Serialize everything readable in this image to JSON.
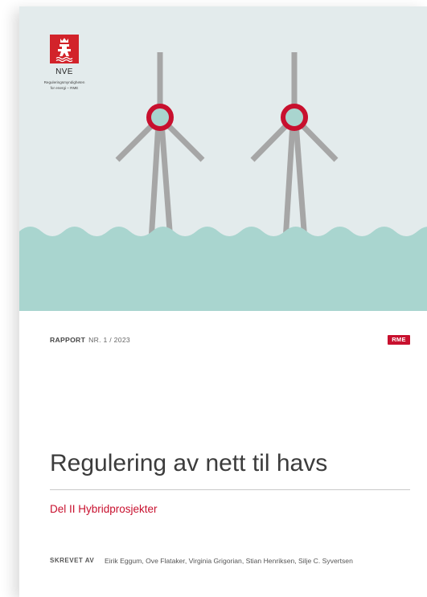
{
  "logo": {
    "icon": "nve-crest-icon",
    "name": "NVE",
    "subtitle_line1": "Reguleringsmyndigheten",
    "subtitle_line2": "for energi – RME"
  },
  "report": {
    "label": "RAPPORT",
    "number": "NR. 1 / 2023",
    "badge": "RME"
  },
  "title": "Regulering av nett til havs",
  "subtitle": "Del II Hybridprosjekter",
  "authors": {
    "label": "SKREVET AV",
    "names": "Eirik Eggum, Ove Flataker, Virginia Grigorian, Stian Henriksen, Silje C. Syvertsen"
  },
  "illustration": {
    "icon": "offshore-wind-turbines-illustration"
  },
  "colors": {
    "accent": "#c8102e",
    "logo_red": "#d2232a",
    "sky": "#e3ebec",
    "water": "#a9d5cf",
    "turbine": "#a6a6a6",
    "text": "#3c3c3c"
  }
}
